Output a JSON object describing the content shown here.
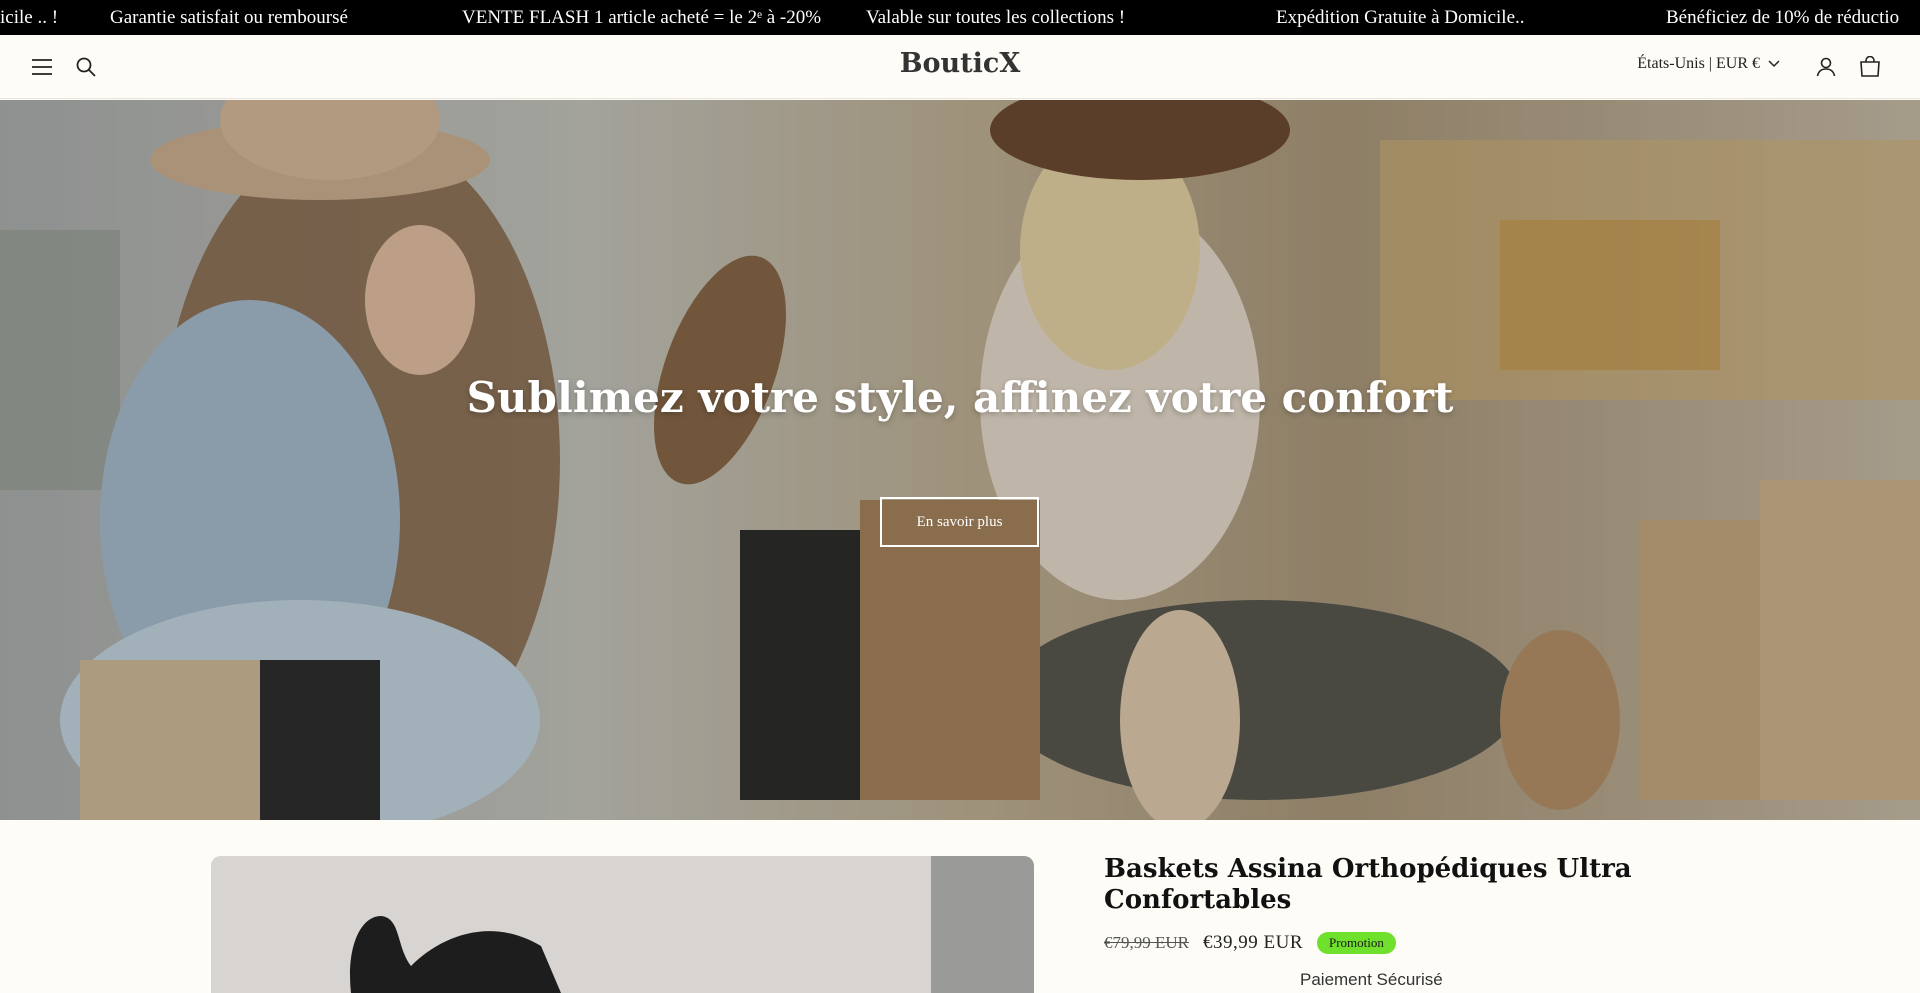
{
  "announcement": {
    "items": [
      "icile .. !",
      "Garantie satisfait ou remboursé",
      "VENTE FLASH 1 article acheté = le 2ᵉ à -20%",
      "Valable sur toutes les collections !",
      "Expédition Gratuite à Domicile..",
      "Bénéficiez de 10% de réductio"
    ]
  },
  "header": {
    "logo": "BouticX",
    "country_currency": "États-Unis | EUR €",
    "icons": [
      "menu-icon",
      "search-icon",
      "chevron-down-icon",
      "account-icon",
      "cart-icon"
    ]
  },
  "hero": {
    "title": "Sublimez votre style, affinez votre confort",
    "button_label": "En savoir plus"
  },
  "product": {
    "title": "Baskets Assina Orthopédiques Ultra Confortables",
    "old_price": "€79,99 EUR",
    "new_price": "€39,99 EUR",
    "badge": "Promotion",
    "secure_payment": "Paiement Sécurisé",
    "badge_color": "#6fe02c"
  }
}
